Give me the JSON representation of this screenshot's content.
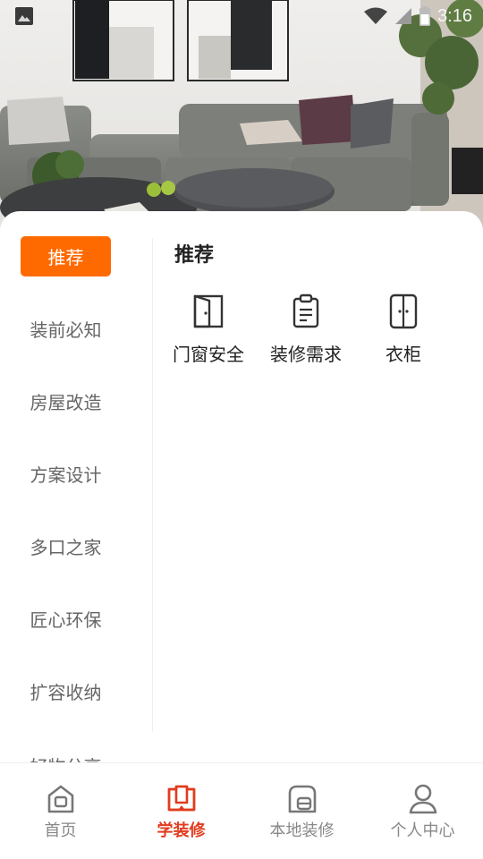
{
  "status_bar": {
    "time": "3:16",
    "icons": [
      "gallery-icon",
      "wifi-icon",
      "signal-icon",
      "battery-icon"
    ]
  },
  "hero": {
    "image": "living-room-photo"
  },
  "sidebar": {
    "items": [
      {
        "label": "推荐",
        "active": true
      },
      {
        "label": "装前必知",
        "active": false
      },
      {
        "label": "房屋改造",
        "active": false
      },
      {
        "label": "方案设计",
        "active": false
      },
      {
        "label": "多口之家",
        "active": false
      },
      {
        "label": "匠心环保",
        "active": false
      },
      {
        "label": "扩容收纳",
        "active": false
      },
      {
        "label": "好物分享",
        "active": false
      }
    ]
  },
  "main": {
    "section_title": "推荐",
    "items": [
      {
        "label": "门窗安全",
        "icon": "door-icon"
      },
      {
        "label": "装修需求",
        "icon": "clipboard-icon"
      },
      {
        "label": "衣柜",
        "icon": "wardrobe-icon"
      }
    ]
  },
  "bottom_nav": {
    "items": [
      {
        "label": "首页",
        "icon": "home-icon",
        "active": false
      },
      {
        "label": "学装修",
        "icon": "book-icon",
        "active": true
      },
      {
        "label": "本地装修",
        "icon": "local-renovation-icon",
        "active": false
      },
      {
        "label": "个人中心",
        "icon": "profile-icon",
        "active": false
      }
    ]
  },
  "colors": {
    "accent": "#ff6a00",
    "nav_active": "#e03c1e",
    "text_primary": "#222222",
    "text_secondary": "#666666",
    "nav_inactive": "#888888"
  }
}
